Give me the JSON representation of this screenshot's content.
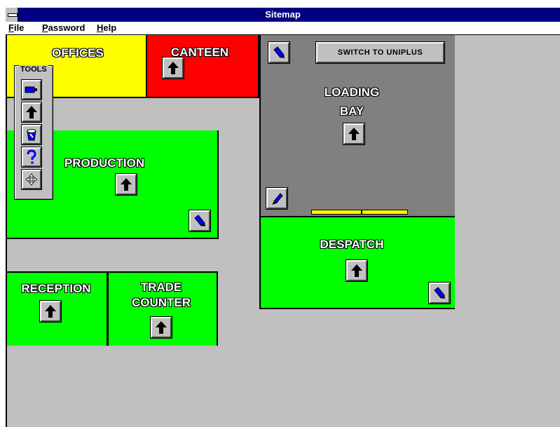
{
  "window": {
    "title": "Sitemap"
  },
  "menu": {
    "file": "File",
    "file_u": "F",
    "file_rest": "ile",
    "password": "Password",
    "password_u": "P",
    "password_rest": "assword",
    "help": "Help",
    "help_u": "H",
    "help_rest": "elp"
  },
  "colors": {
    "offices": "#ffff00",
    "canteen": "#ff0000",
    "loading_bay": "#808080",
    "green_room": "#00ff00",
    "dock": "#ffff00"
  },
  "rooms": {
    "offices": "OFFICES",
    "canteen": "CANTEEN",
    "loading_bay": "LOADING\nBAY",
    "production": "PRODUCTION",
    "despatch": "DESPATCH",
    "reception": "RECEPTION",
    "trade_counter": "TRADE\nCOUNTER"
  },
  "switch_button": "SWITCH TO UNIPLUS",
  "tools": {
    "label": "TOOLS",
    "items": [
      "pen-tool-icon",
      "arrow-up-icon",
      "bucket-icon",
      "help-icon",
      "move-icon"
    ]
  }
}
